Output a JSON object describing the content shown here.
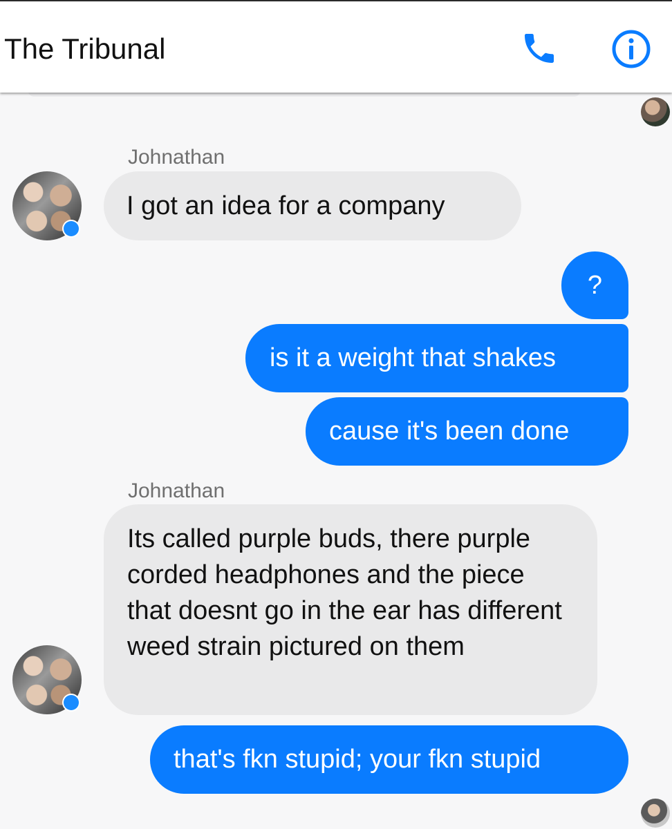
{
  "header": {
    "title": "The Tribunal",
    "call_icon": "phone-icon",
    "info_icon": "info-icon"
  },
  "colors": {
    "accent": "#0a7cff",
    "incoming_bubble": "#e9e9ea",
    "background": "#f7f7f8"
  },
  "messages": [
    {
      "sender": "Johnathan",
      "text": "I got an idea for a company",
      "direction": "incoming"
    },
    {
      "text": "?",
      "direction": "outgoing"
    },
    {
      "text": "is it a weight that shakes",
      "direction": "outgoing"
    },
    {
      "text": "cause it's been done",
      "direction": "outgoing"
    },
    {
      "sender": "Johnathan",
      "text": "Its called purple buds, there purple corded headphones and the piece that doesnt go in the ear has different weed strain pictured on them",
      "direction": "incoming"
    },
    {
      "text": "that's fkn stupid; your fkn stupid",
      "direction": "outgoing"
    }
  ]
}
